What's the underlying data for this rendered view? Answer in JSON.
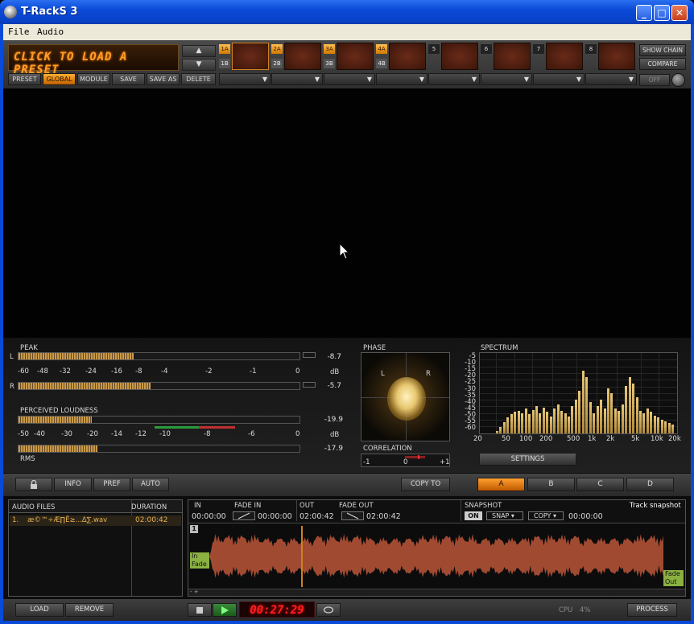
{
  "window": {
    "title": "T-RackS  3"
  },
  "menu": [
    "File",
    "Audio"
  ],
  "preset": {
    "display": "CLICK TO LOAD A PRESET",
    "up_label": "▲",
    "down_label": "▼",
    "buttons": [
      "PRESET",
      "GLOBAL",
      "MODULE",
      "SAVE",
      "SAVE AS",
      "DELETE"
    ],
    "active": "GLOBAL"
  },
  "slots": [
    {
      "a": "1A",
      "b": "1B"
    },
    {
      "a": "2A",
      "b": "2B"
    },
    {
      "a": "3A",
      "b": "3B"
    },
    {
      "a": "4A",
      "b": "4B"
    },
    {
      "a": "5",
      "b": ""
    },
    {
      "a": "6",
      "b": ""
    },
    {
      "a": "7",
      "b": ""
    },
    {
      "a": "8",
      "b": ""
    }
  ],
  "chain": {
    "show_chain": "SHOW CHAIN",
    "compare": "COMPARE",
    "off": "OFF"
  },
  "peak": {
    "title": "PEAK",
    "l_label": "L",
    "r_label": "R",
    "scale": [
      "-60",
      "-48",
      "-32",
      "-24",
      "-16",
      "-8",
      "-4",
      "-2",
      "-1",
      "0"
    ],
    "l_value": "-8.7",
    "r_value": "-5.7",
    "unit": "dB",
    "l_level": 0.41,
    "r_level": 0.47
  },
  "loudness": {
    "title": "PERCEIVED LOUDNESS",
    "scale": [
      "-50",
      "-40",
      "-30",
      "-20",
      "-14",
      "-12",
      "-10",
      "-8",
      "-6",
      "0"
    ],
    "value": "-19.9",
    "unit": "dB",
    "rms_value": "-17.9",
    "rms_label": "RMS",
    "loud_level": 0.26,
    "rms_level": 0.28
  },
  "phase": {
    "title": "PHASE",
    "l": "L",
    "r": "R"
  },
  "correlation": {
    "title": "CORRELATION",
    "min": "-1",
    "mid": "0",
    "max": "+1"
  },
  "spectrum": {
    "title": "SPECTRUM",
    "y_ticks": [
      "-5",
      "-10",
      "-15",
      "-20",
      "-25",
      "-30",
      "-35",
      "-40",
      "-45",
      "-50",
      "-55",
      "-60"
    ],
    "x_ticks": [
      "20",
      "50",
      "100",
      "200",
      "500",
      "1k",
      "2k",
      "5k",
      "10k",
      "20k"
    ],
    "settings_label": "SETTINGS"
  },
  "controls": {
    "lock_icon": "lock-icon",
    "info": "INFO",
    "pref": "PREF",
    "auto": "AUTO",
    "copy_to": "COPY TO",
    "snapshots": [
      "A",
      "B",
      "C",
      "D"
    ],
    "active_snapshot": "A"
  },
  "files": {
    "header_name": "AUDIO FILES",
    "header_duration": "DURATION",
    "items": [
      {
        "index": "1.",
        "name": "æ©™÷Æ∏Ë≥...Δ∑.wav",
        "duration": "02:00:42"
      }
    ]
  },
  "track": {
    "in_label": "IN",
    "in_value": "00:00:00",
    "fade_in_label": "FADE IN",
    "fade_in_value": "00:00:00",
    "out_label": "OUT",
    "out_value": "02:00:42",
    "fade_out_label": "FADE OUT",
    "fade_out_value": "02:00:42",
    "snapshot_label": "SNAPSHOT",
    "snapshot_on": "ON",
    "snap": "SNAP",
    "copy": "COPY",
    "snapshot_time": "00:00:00",
    "track_snapshot": "Track snapshot",
    "marker": "1",
    "in_fade_1": "In",
    "in_fade_2": "Fade",
    "fade_out_1": "Fade",
    "fade_out_2": "Out",
    "zoom": "- +"
  },
  "transport": {
    "load": "LOAD",
    "remove": "REMOVE",
    "time": "00:27:29",
    "cpu_label": "CPU",
    "cpu_value": "4%",
    "process": "PROCESS"
  },
  "colors": {
    "accent": "#ff9e28",
    "waveform": "#a04a32",
    "led": "#ff2020"
  }
}
